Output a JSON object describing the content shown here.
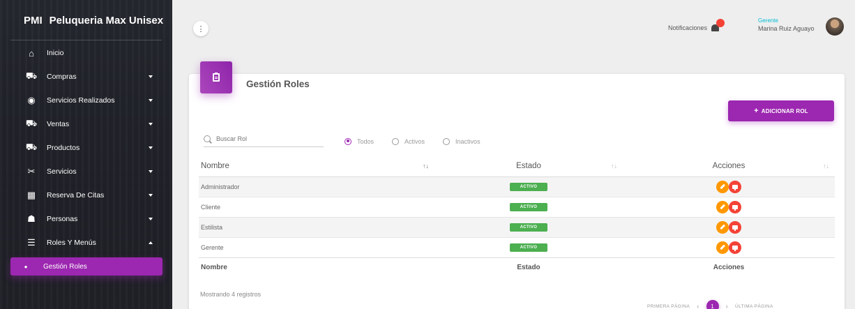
{
  "brand": {
    "short": "PMI",
    "name": "Peluqueria Max Unisex"
  },
  "sidebar": {
    "items": [
      {
        "label": "Inicio",
        "icon": "home-icon",
        "glyph": "⌂",
        "caret": ""
      },
      {
        "label": "Compras",
        "icon": "cart-icon",
        "glyph": "⛟",
        "caret": "down"
      },
      {
        "label": "Servicios Realizados",
        "icon": "gauge-icon",
        "glyph": "◉",
        "caret": "down"
      },
      {
        "label": "Ventas",
        "icon": "shopping-cart-icon",
        "glyph": "⛟",
        "caret": "down"
      },
      {
        "label": "Productos",
        "icon": "product-cart-icon",
        "glyph": "⛟",
        "caret": "down"
      },
      {
        "label": "Servicios",
        "icon": "scissors-icon",
        "glyph": "✂",
        "caret": "down"
      },
      {
        "label": "Reserva De Citas",
        "icon": "calendar-icon",
        "glyph": "▦",
        "caret": "down"
      },
      {
        "label": "Personas",
        "icon": "person-icon",
        "glyph": "☗",
        "caret": "down"
      },
      {
        "label": "Roles Y Menús",
        "icon": "list-icon",
        "glyph": "☰",
        "caret": "up"
      }
    ],
    "active": {
      "label": "Gestión Roles",
      "icon": "dot-icon",
      "glyph": "●"
    }
  },
  "topbar": {
    "menu_glyph": "⋮",
    "notifications_label": "Notificaciones",
    "notifications_count": "",
    "user_role": "Gerente",
    "user_name": "Marina Ruiz Aguayo"
  },
  "card": {
    "title": "Gestión Roles",
    "add_button_label": "ADICIONAR ROL",
    "search_placeholder": "Buscar Rol",
    "filters": [
      "Todos",
      "Activos",
      "Inactivos"
    ],
    "selected_filter": "Todos",
    "columns": [
      "Nombre",
      "Estado",
      "Acciones"
    ],
    "rows": [
      {
        "name": "Administrador",
        "status": "ACTIVO"
      },
      {
        "name": "Cliente",
        "status": "ACTIVO"
      },
      {
        "name": "Estilista",
        "status": "ACTIVO"
      },
      {
        "name": "Gerente",
        "status": "ACTIVO"
      }
    ],
    "footer_columns": [
      "Nombre",
      "Estado",
      "Acciones"
    ],
    "record_count_text": "Mostrando 4 registros",
    "pagination": {
      "first": "PRIMERA PÁGINA",
      "prev": "‹",
      "current": "1",
      "next": "›",
      "last": "ÚLTIMA PÁGINA"
    }
  },
  "colors": {
    "accent": "#9c27b0",
    "edit": "#ff9800",
    "delete": "#f44336",
    "status": "#4caf50",
    "role": "#00bcd4"
  }
}
